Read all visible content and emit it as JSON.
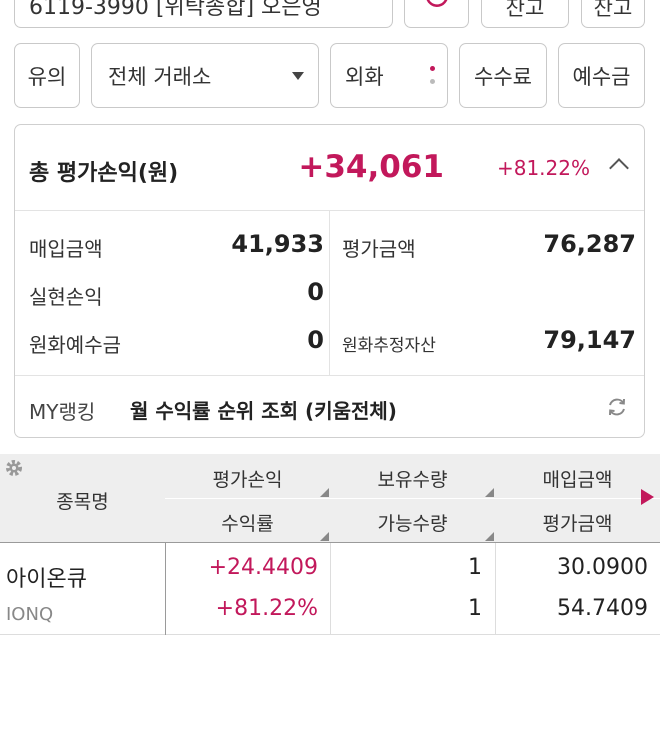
{
  "top": {
    "account_text": "6119-3990 [위탁종합] 오은영",
    "balance_label": "잔고",
    "balance2_label": "잔고"
  },
  "filters": {
    "notice": "유의",
    "exchange": "전체 거래소",
    "fx": "외화",
    "fee": "수수료",
    "deposit": "예수금"
  },
  "summary": {
    "title": "총 평가손익(원)",
    "total_pnl": "+34,061",
    "total_rate": "+81.22%",
    "purchase_label": "매입금액",
    "purchase_value": "41,933",
    "eval_label": "평가금액",
    "eval_value": "76,287",
    "realized_label": "실현손익",
    "realized_value": "0",
    "krw_deposit_label": "원화예수금",
    "krw_deposit_value": "0",
    "krw_est_assets_label": "원화추정자산",
    "krw_est_assets_value": "79,147"
  },
  "ranking": {
    "label": "MY랭킹",
    "text": "월 수익률 순위 조회 (키움전체)"
  },
  "table": {
    "headers": {
      "name": "종목명",
      "pnl": "평가손익",
      "rate": "수익률",
      "holding_qty": "보유수량",
      "available_qty": "가능수량",
      "purchase_amt": "매입금액",
      "eval_amt": "평가금액"
    },
    "rows": [
      {
        "name": "아이온큐",
        "ticker": "IONQ",
        "pnl": "+24.4409",
        "rate": "+81.22%",
        "holding_qty": "1",
        "available_qty": "1",
        "purchase_amt": "30.0900",
        "eval_amt": "54.7409"
      }
    ]
  },
  "colors": {
    "accent": "#c2185b",
    "border": "#c9c9c9",
    "header_bg": "#eeeeee"
  }
}
